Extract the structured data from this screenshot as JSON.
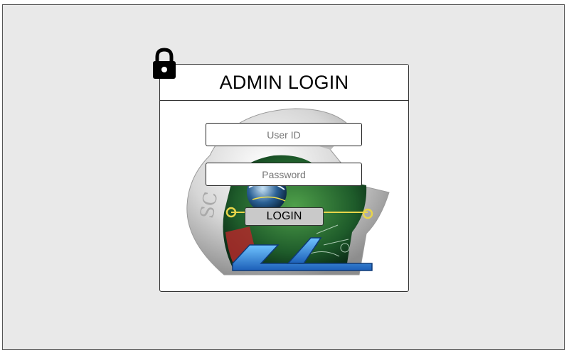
{
  "login": {
    "title": "ADMIN LOGIN",
    "user_id_placeholder": "User ID",
    "user_id_value": "",
    "password_placeholder": "Password",
    "password_value": "",
    "submit_label": "LOGIN"
  },
  "icons": {
    "lock": "lock-icon",
    "emblem": "sc-emblem-logo"
  },
  "colors": {
    "background": "#e9e9e9",
    "card": "#ffffff",
    "button": "#c9c9c9"
  },
  "logo": {
    "text": "SC"
  }
}
